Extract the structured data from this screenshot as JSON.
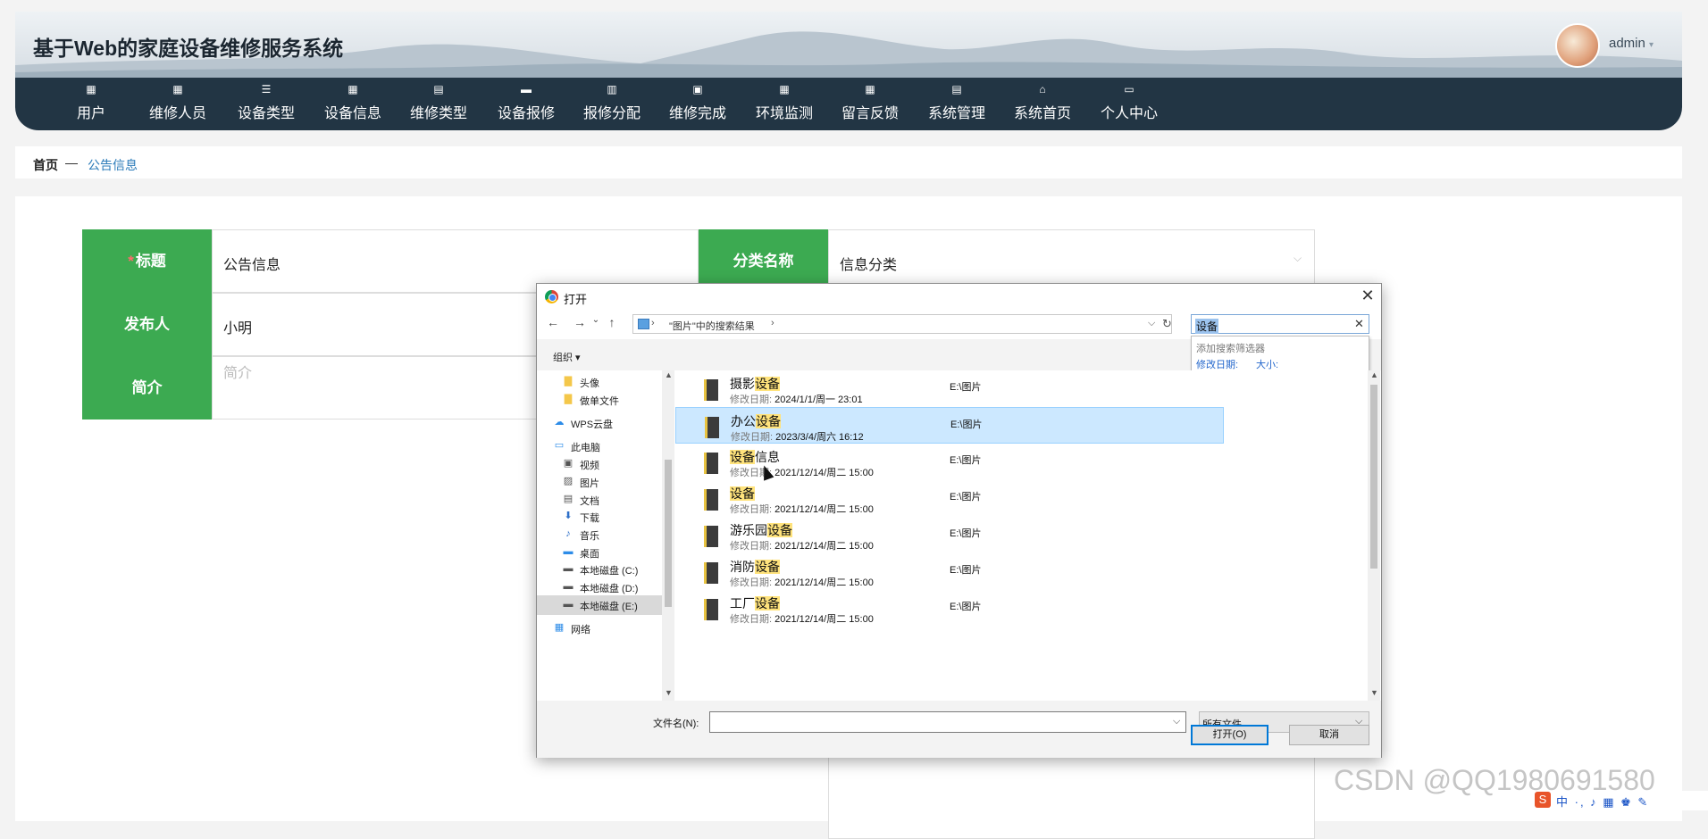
{
  "header": {
    "site_title": "基于Web的家庭设备维修服务系统",
    "user_name": "admin"
  },
  "nav": [
    {
      "label": "用户",
      "icon": "grid-icon"
    },
    {
      "label": "维修人员",
      "icon": "grid-icon"
    },
    {
      "label": "设备类型",
      "icon": "list-icon"
    },
    {
      "label": "设备信息",
      "icon": "grid-icon"
    },
    {
      "label": "维修类型",
      "icon": "clipboard-icon"
    },
    {
      "label": "设备报修",
      "icon": "chat-icon"
    },
    {
      "label": "报修分配",
      "icon": "books-icon"
    },
    {
      "label": "维修完成",
      "icon": "clipboard-check-icon"
    },
    {
      "label": "环境监测",
      "icon": "grid-icon"
    },
    {
      "label": "留言反馈",
      "icon": "grid-icon"
    },
    {
      "label": "系统管理",
      "icon": "clipboard-icon"
    },
    {
      "label": "系统首页",
      "icon": "home-icon"
    },
    {
      "label": "个人中心",
      "icon": "window-icon"
    }
  ],
  "breadcrumb": {
    "home": "首页",
    "separator": "—",
    "current": "公告信息"
  },
  "form": {
    "title_label": "标题",
    "title_value": "公告信息",
    "category_label": "分类名称",
    "category_value": "信息分类",
    "publisher_label": "发布人",
    "publisher_value": "小明",
    "intro_label": "简介",
    "intro_placeholder": "简介",
    "required_mark": "*"
  },
  "dialog": {
    "title": "打开",
    "address": "\"图片\"中的搜索结果",
    "address_sep": "›",
    "search_value": "设备",
    "suggest_title": "添加搜索筛选器",
    "suggest_date": "修改日期:",
    "suggest_size": "大小:",
    "organize": "组织 ▾",
    "tree": [
      {
        "label": "头像",
        "icon": "folder-icon"
      },
      {
        "label": "做单文件",
        "icon": "folder-icon"
      },
      {
        "label": "WPS云盘",
        "icon": "cloud-icon"
      },
      {
        "label": "此电脑",
        "icon": "computer-icon"
      },
      {
        "label": "视频",
        "icon": "video-icon"
      },
      {
        "label": "图片",
        "icon": "picture-icon"
      },
      {
        "label": "文档",
        "icon": "document-icon"
      },
      {
        "label": "下载",
        "icon": "download-icon"
      },
      {
        "label": "音乐",
        "icon": "music-icon"
      },
      {
        "label": "桌面",
        "icon": "desktop-icon"
      },
      {
        "label": "本地磁盘 (C:)",
        "icon": "disk-icon"
      },
      {
        "label": "本地磁盘 (D:)",
        "icon": "disk-icon"
      },
      {
        "label": "本地磁盘 (E:)",
        "icon": "disk-icon"
      },
      {
        "label": "网络",
        "icon": "network-icon"
      }
    ],
    "files": [
      {
        "pre": "摄影",
        "hit": "设备",
        "post": "",
        "date_label": "修改日期: ",
        "date": "2024/1/1/周一 23:01",
        "location": "E:\\图片"
      },
      {
        "pre": "办公",
        "hit": "设备",
        "post": "",
        "date_label": "修改日期: ",
        "date": "2023/3/4/周六 16:12",
        "location": "E:\\图片"
      },
      {
        "pre": "",
        "hit": "设备",
        "post": "信息",
        "date_label": "修改日期: ",
        "date": "2021/12/14/周二 15:00",
        "location": "E:\\图片"
      },
      {
        "pre": "",
        "hit": "设备",
        "post": "",
        "date_label": "修改日期: ",
        "date": "2021/12/14/周二 15:00",
        "location": "E:\\图片"
      },
      {
        "pre": "游乐园",
        "hit": "设备",
        "post": "",
        "date_label": "修改日期: ",
        "date": "2021/12/14/周二 15:00",
        "location": "E:\\图片"
      },
      {
        "pre": "消防",
        "hit": "设备",
        "post": "",
        "date_label": "修改日期: ",
        "date": "2021/12/14/周二 15:00",
        "location": "E:\\图片"
      },
      {
        "pre": "工厂",
        "hit": "设备",
        "post": "",
        "date_label": "修改日期: ",
        "date": "2021/12/14/周二 15:00",
        "location": "E:\\图片"
      }
    ],
    "filename_label": "文件名(N):",
    "filename_value": "",
    "filetype": "所有文件",
    "open_label": "打开(O)",
    "cancel_label": "取消"
  },
  "watermark": "CSDN @QQ1980691580",
  "tray": "中 ·, ♪ ▦ ♚ ✎"
}
